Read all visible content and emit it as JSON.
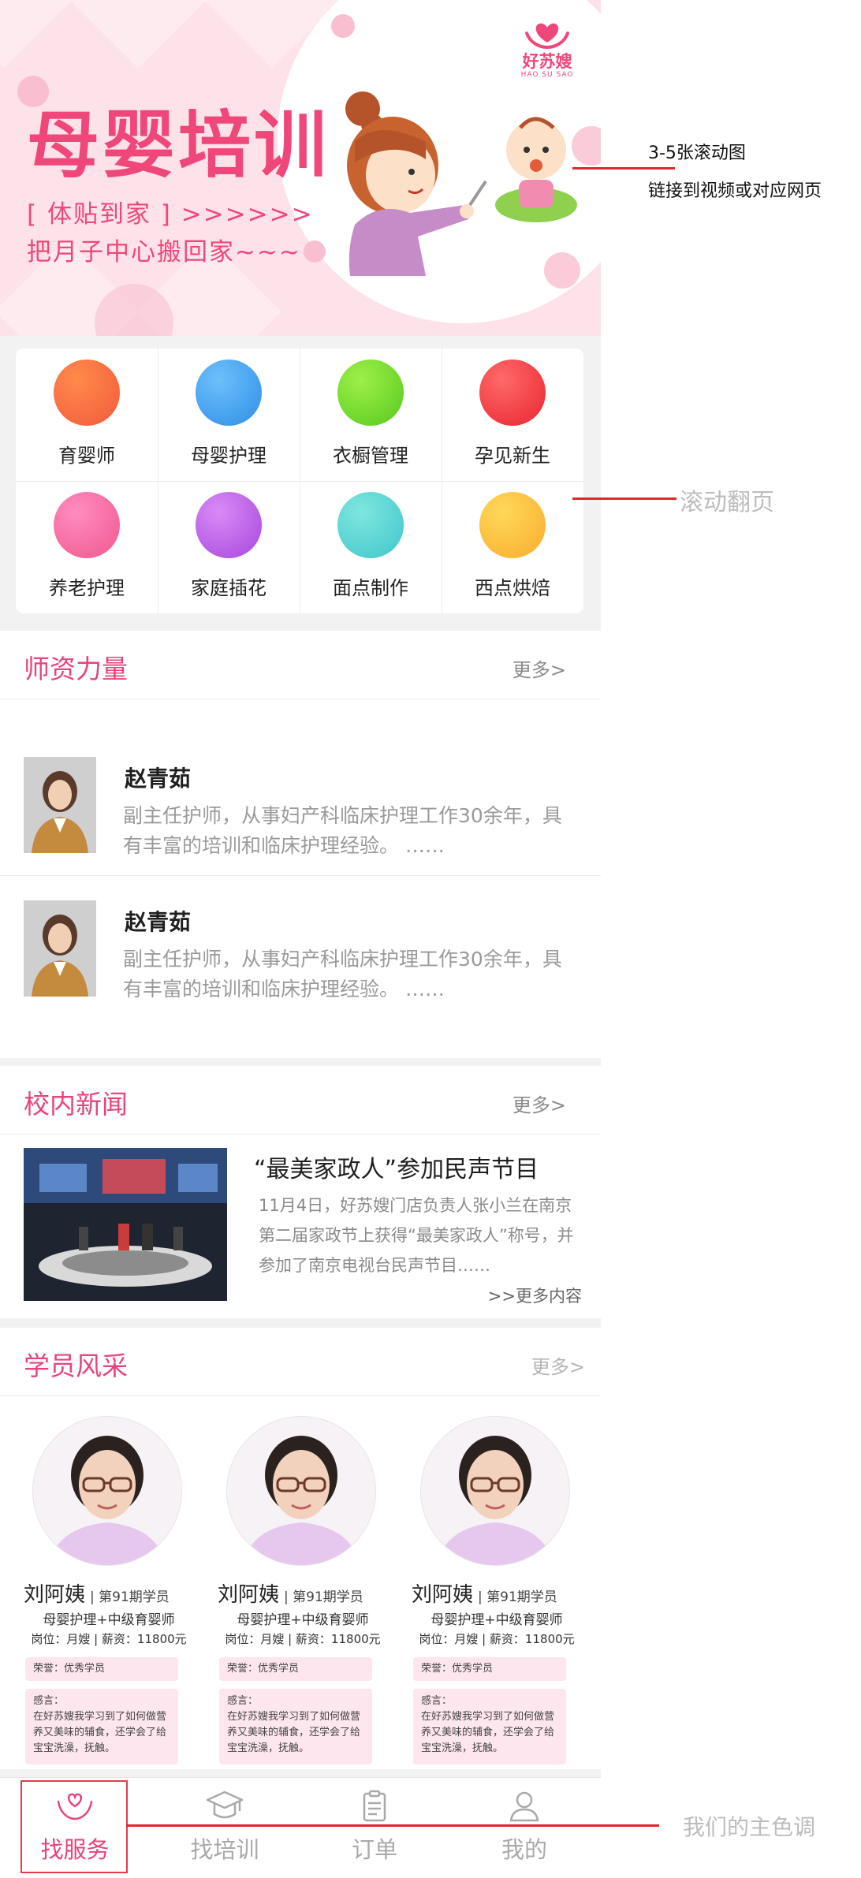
{
  "banner": {
    "title": "母婴培训",
    "subtitle1": "[ 体贴到家 ] >>>>>>",
    "subtitle2": "把月子中心搬回家~~~",
    "brand_name": "好苏嫂",
    "brand_en": "HAO SU SAO"
  },
  "categories": [
    {
      "label": "育婴师",
      "color_a": "#ff8a4a",
      "color_b": "#f25a3d"
    },
    {
      "label": "母婴护理",
      "color_a": "#6cc0fb",
      "color_b": "#2f8ee6"
    },
    {
      "label": "衣橱管理",
      "color_a": "#9ef04a",
      "color_b": "#57c91c"
    },
    {
      "label": "孕见新生",
      "color_a": "#ff6a6a",
      "color_b": "#e8252f"
    },
    {
      "label": "养老护理",
      "color_a": "#ff8cbf",
      "color_b": "#f0578f"
    },
    {
      "label": "家庭插花",
      "color_a": "#d98af6",
      "color_b": "#a647dd"
    },
    {
      "label": "面点制作",
      "color_a": "#7fe6de",
      "color_b": "#3fc6cc"
    },
    {
      "label": "西点烘焙",
      "color_a": "#ffd85a",
      "color_b": "#f9ac2c"
    }
  ],
  "teachers_section": {
    "title": "师资力量",
    "more": "更多>",
    "items": [
      {
        "name": "赵青茹",
        "desc": "副主任护师，从事妇产科临床护理工作30余年，具有丰富的培训和临床护理经验。  ……"
      },
      {
        "name": "赵青茹",
        "desc": "副主任护师，从事妇产科临床护理工作30余年，具有丰富的培训和临床护理经验。  ……"
      }
    ]
  },
  "news_section": {
    "title": "校内新闻",
    "more": "更多>",
    "headline": "“最美家政人”参加民声节目",
    "body": "11月4日，好苏嫂门店负责人张小兰在南京第二届家政节上获得“最美家政人”称号，并参加了南京电视台民声节目……",
    "more_content": ">>更多内容"
  },
  "students_section": {
    "title": "学员风采",
    "more": "更多>",
    "items": [
      {
        "name": "刘阿姨",
        "cls": "| 第91期学员",
        "cert": "母婴护理+中级育婴师",
        "job": "岗位：月嫂  |  薪资：11800元",
        "honor": "荣誉：优秀学员",
        "feel": "感言：\n在好苏嫂我学习到了如何做营养又美味的辅食，还学会了给宝宝洗澡，抚触。"
      },
      {
        "name": "刘阿姨",
        "cls": "| 第91期学员",
        "cert": "母婴护理+中级育婴师",
        "job": "岗位：月嫂  |  薪资：11800元",
        "honor": "荣誉：优秀学员",
        "feel": "感言：\n在好苏嫂我学习到了如何做营养又美味的辅食，还学会了给宝宝洗澡，抚触。"
      },
      {
        "name": "刘阿姨",
        "cls": "| 第91期学员",
        "cert": "母婴护理+中级育婴师",
        "job": "岗位：月嫂  |  薪资：11800元",
        "honor": "荣誉：优秀学员",
        "feel": "感言：\n在好苏嫂我学习到了如何做营养又美味的辅食，还学会了给宝宝洗澡，抚触。"
      }
    ]
  },
  "tabbar": [
    {
      "label": "找服务",
      "icon": "hands-heart-icon",
      "active": true
    },
    {
      "label": "找培训",
      "icon": "graduation-cap-icon",
      "active": false
    },
    {
      "label": "订单",
      "icon": "clipboard-icon",
      "active": false
    },
    {
      "label": "我的",
      "icon": "user-icon",
      "active": false
    }
  ],
  "annotations": {
    "banner_note1": "3-5张滚动图",
    "banner_note2": "链接到视频或对应网页",
    "grid_note": "滚动翻页",
    "color_note": "我们的主色调"
  },
  "colors": {
    "primary": "#e8447a",
    "annotation_line": "#e0262d"
  }
}
